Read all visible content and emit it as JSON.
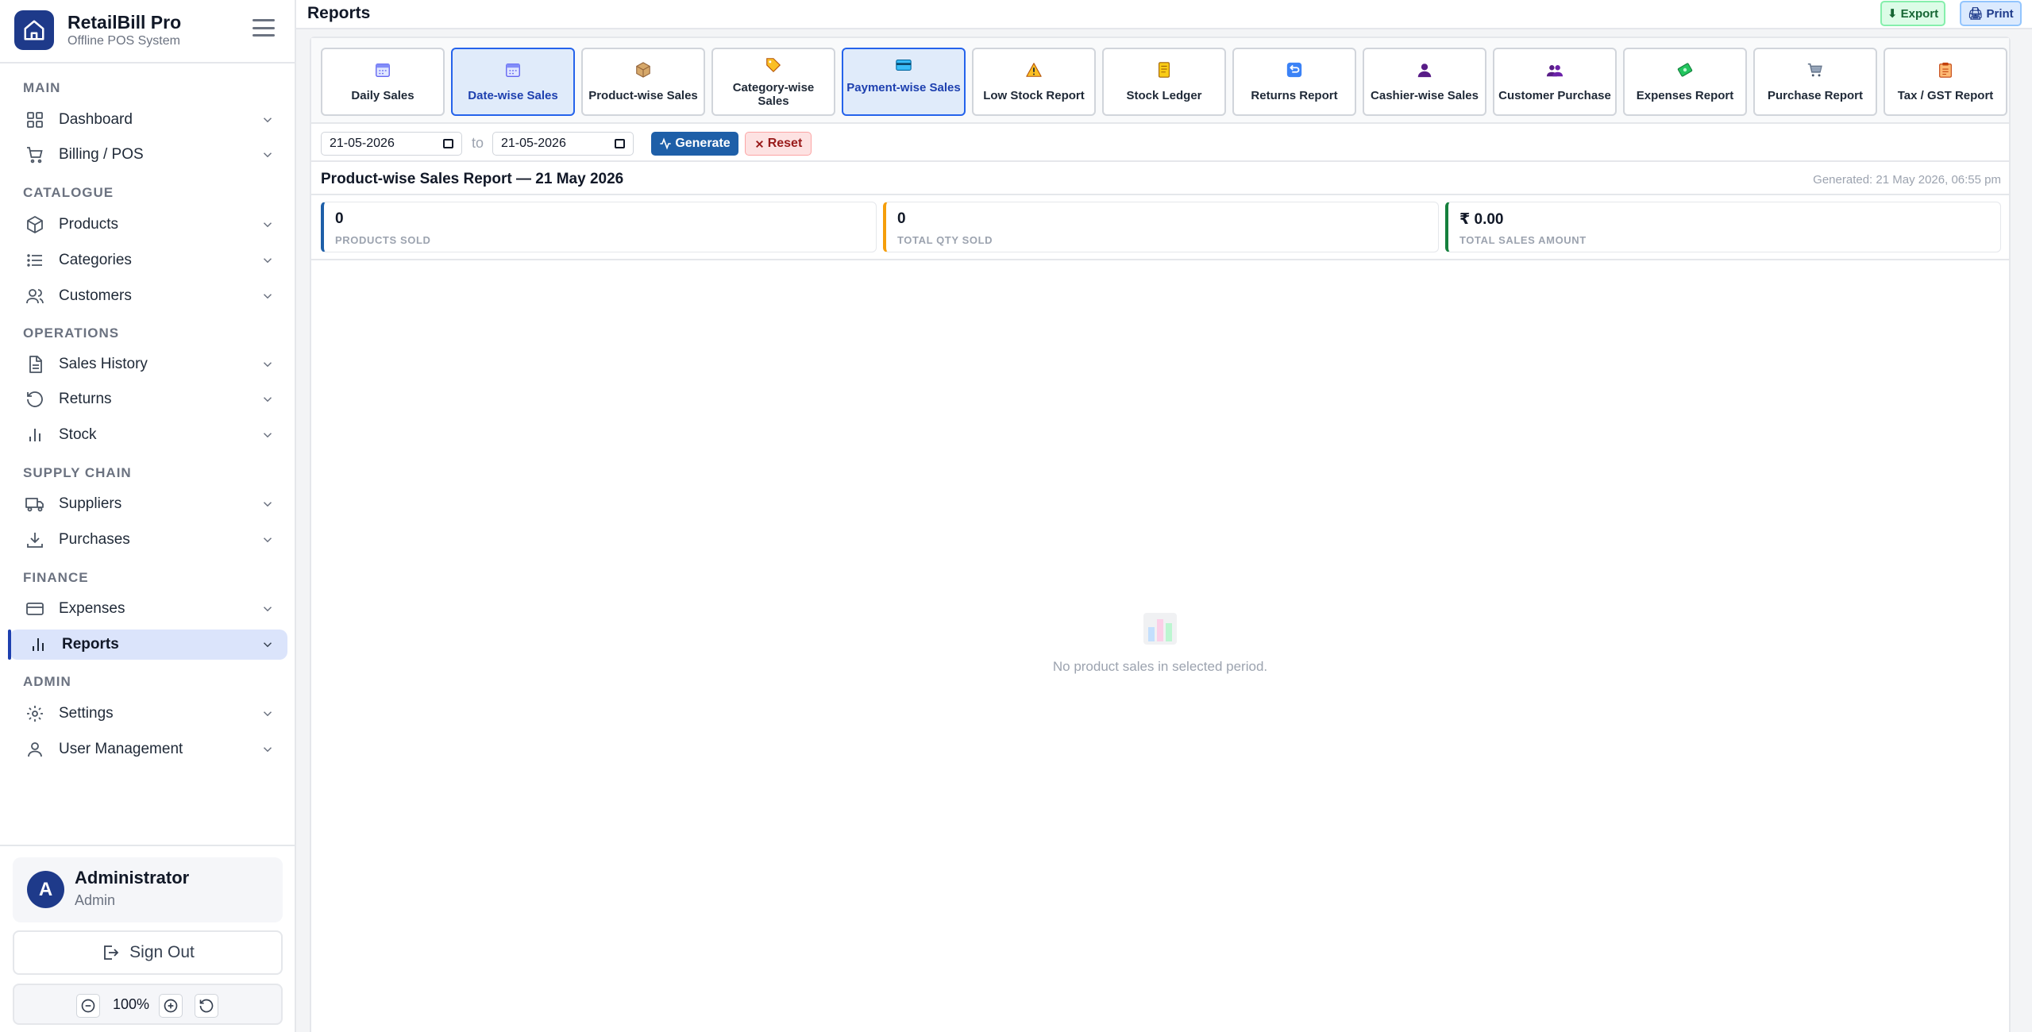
{
  "app": {
    "title": "RetailBill Pro",
    "subtitle": "Offline POS System"
  },
  "sidebar": {
    "sections": {
      "main": "MAIN",
      "catalogue": "CATALOGUE",
      "operations": "OPERATIONS",
      "supply_chain": "SUPPLY CHAIN",
      "finance": "FINANCE",
      "admin": "ADMIN"
    },
    "items": {
      "dashboard": "Dashboard",
      "billing": "Billing / POS",
      "products": "Products",
      "categories": "Categories",
      "customers": "Customers",
      "sales_history": "Sales History",
      "returns": "Returns",
      "stock": "Stock",
      "suppliers": "Suppliers",
      "purchases": "Purchases",
      "expenses": "Expenses",
      "reports": "Reports",
      "settings": "Settings",
      "user_management": "User Management"
    },
    "active_item": "Reports"
  },
  "user": {
    "initial": "A",
    "name": "Administrator",
    "role": "Admin"
  },
  "sign_out_label": "Sign Out",
  "zoom": {
    "level": "100%"
  },
  "header": {
    "title": "Reports",
    "export_label": "⬇ Export",
    "print_label": "🖨 Print"
  },
  "report_tabs": [
    {
      "label": "Daily Sales",
      "icon": "calendar-icon"
    },
    {
      "label": "Date-wise Sales",
      "icon": "calendar-icon"
    },
    {
      "label": "Product-wise Sales",
      "icon": "package-icon"
    },
    {
      "label": "Category-wise Sales",
      "icon": "tag-icon"
    },
    {
      "label": "Payment-wise Sales",
      "icon": "credit-card-icon"
    },
    {
      "label": "Low Stock Report",
      "icon": "warning-icon"
    },
    {
      "label": "Stock Ledger",
      "icon": "ledger-icon"
    },
    {
      "label": "Returns Report",
      "icon": "return-icon"
    },
    {
      "label": "Cashier-wise Sales",
      "icon": "person-icon"
    },
    {
      "label": "Customer Purchase",
      "icon": "people-icon"
    },
    {
      "label": "Expenses Report",
      "icon": "money-icon"
    },
    {
      "label": "Purchase Report",
      "icon": "cart-icon"
    },
    {
      "label": "Tax / GST Report",
      "icon": "clipboard-icon"
    }
  ],
  "filters": {
    "from_date": "21-05-2026",
    "to_label": "to",
    "to_date": "21-05-2026",
    "generate_label": "Generate",
    "reset_label": "Reset"
  },
  "report": {
    "title": "Product-wise Sales Report — 21 May 2026",
    "generated": "Generated: 21 May 2026, 06:55 pm",
    "stats": [
      {
        "value": "0",
        "label": "PRODUCTS SOLD",
        "color": "#1e5fa8"
      },
      {
        "value": "0",
        "label": "TOTAL QTY SOLD",
        "color": "#f59e0b"
      },
      {
        "value": "₹ 0.00",
        "label": "TOTAL SALES AMOUNT",
        "color": "#15803d"
      }
    ],
    "empty_message": "No product sales in selected period."
  },
  "colors": {
    "brand": "#1e3a8a",
    "active_nav_bg": "#dbe4fb",
    "primary_button": "#1e5fa8"
  }
}
